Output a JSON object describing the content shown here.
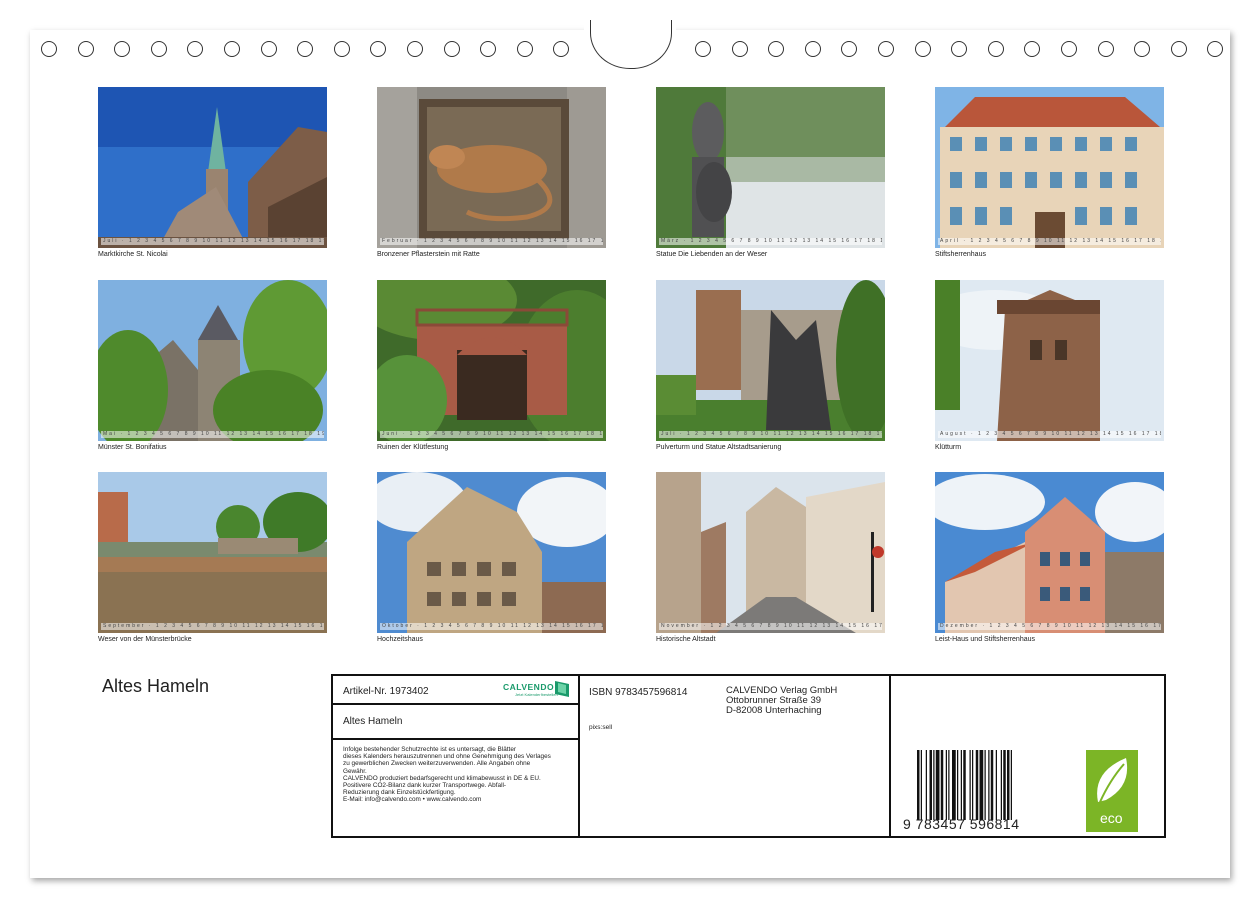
{
  "calendar_title": "Altes Hameln",
  "photos": [
    {
      "caption": "Marktkirche St. Nicolai",
      "month": "Juli"
    },
    {
      "caption": "Bronzener Pflasterstein mit Ratte",
      "month": "Februar"
    },
    {
      "caption": "Statue Die Liebenden an der Weser",
      "month": "März"
    },
    {
      "caption": "Stiftsherrenhaus",
      "month": "April"
    },
    {
      "caption": "Münster St. Bonifatius",
      "month": "Mai"
    },
    {
      "caption": "Ruinen der Klütfestung",
      "month": "Juni"
    },
    {
      "caption": "Pulverturm und Statue Altstadtsanierung",
      "month": "Juli"
    },
    {
      "caption": "Klütturm",
      "month": "August"
    },
    {
      "caption": "Weser von der Münsterbrücke",
      "month": "September"
    },
    {
      "caption": "Hochzeitshaus",
      "month": "Oktober"
    },
    {
      "caption": "Historische Altstadt",
      "month": "November"
    },
    {
      "caption": "Leist-Haus und Stiftsherrenhaus",
      "month": "Dezember"
    }
  ],
  "info": {
    "article": "Artikel-Nr. 1973402",
    "logo_text": "CALVENDO",
    "logo_sub": "Jetzt Kalender!bestellen",
    "title": "Altes Hameln",
    "isbn": "ISBN 9783457596814",
    "publisher_lines": [
      "CALVENDO Verlag GmbH",
      "Ottobrunner Straße 39",
      "D-82008 Unterhaching"
    ],
    "credit": "pixs:sell",
    "legal_lines": [
      "Infolge bestehender Schutzrechte ist es untersagt, die Blätter",
      "dieses Kalenders herauszutrennen und ohne Genehmigung des Verlages",
      "zu gewerblichen Zwecken weiterzuverwenden. Alle Angaben ohne",
      "Gewähr.",
      "CALVENDO produziert bedarfsgerecht und klimabewusst in DE & EU.",
      "Positivere CO2-Bilanz dank kurzer Transportwege. Abfall-",
      "Reduzierung dank Einzelstückfertigung.",
      "E-Mail: info@calvendo.com • www.calvendo.com"
    ],
    "barcode_digits": "9  783457  596814",
    "eco_label": "eco"
  },
  "colors": {
    "frame": "#111111",
    "eco": "#7cb526",
    "calvendo_green": "#1a9a6b"
  }
}
